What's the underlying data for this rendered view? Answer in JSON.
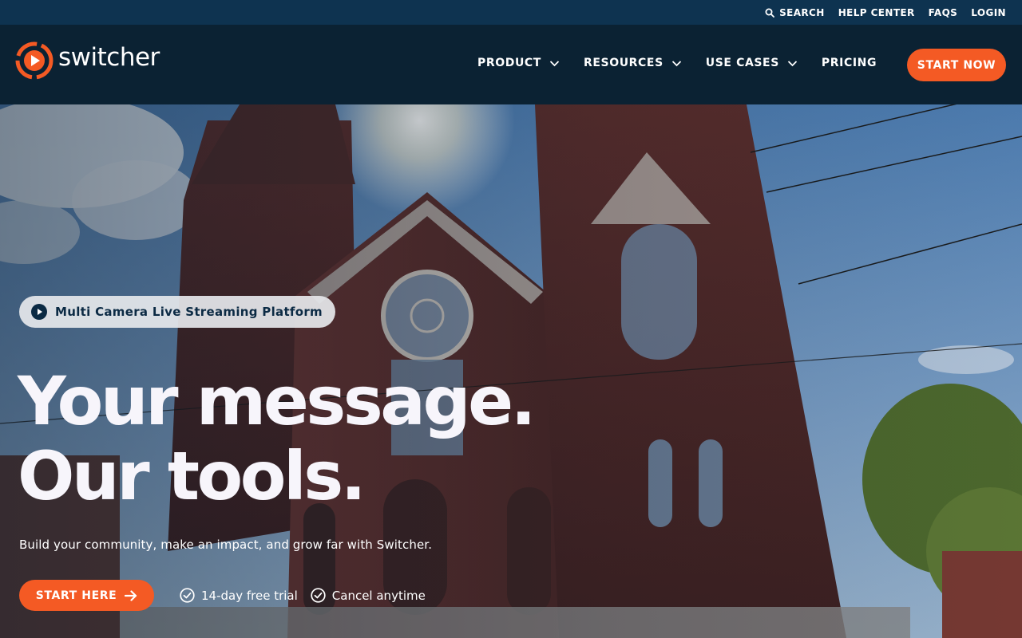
{
  "utility_nav": {
    "search": "SEARCH",
    "help_center": "HELP CENTER",
    "faqs": "FAQS",
    "login": "LOGIN"
  },
  "brand": {
    "name": "switcher",
    "accent": "#f45a24",
    "nav_bg": "#0b2233",
    "utility_bg": "#0e3350"
  },
  "nav": {
    "items": [
      {
        "label": "PRODUCT",
        "dropdown": true
      },
      {
        "label": "RESOURCES",
        "dropdown": true
      },
      {
        "label": "USE CASES",
        "dropdown": true
      },
      {
        "label": "PRICING",
        "dropdown": false
      }
    ],
    "cta": "START NOW"
  },
  "hero": {
    "badge": "Multi Camera Live Streaming Platform",
    "headline_line1": "Your message.",
    "headline_line2": "Our tools.",
    "subtext": "Build your community, make an impact, and grow far with Switcher.",
    "cta": "START HERE",
    "perks": [
      "14-day free trial",
      "Cancel anytime"
    ],
    "background": "church-photo"
  },
  "icons": {
    "search": "search-icon",
    "chevron": "chevron-down-icon",
    "play": "play-icon",
    "arrow": "arrow-right-icon",
    "check": "check-circle-icon",
    "logo": "switcher-logo-icon"
  }
}
